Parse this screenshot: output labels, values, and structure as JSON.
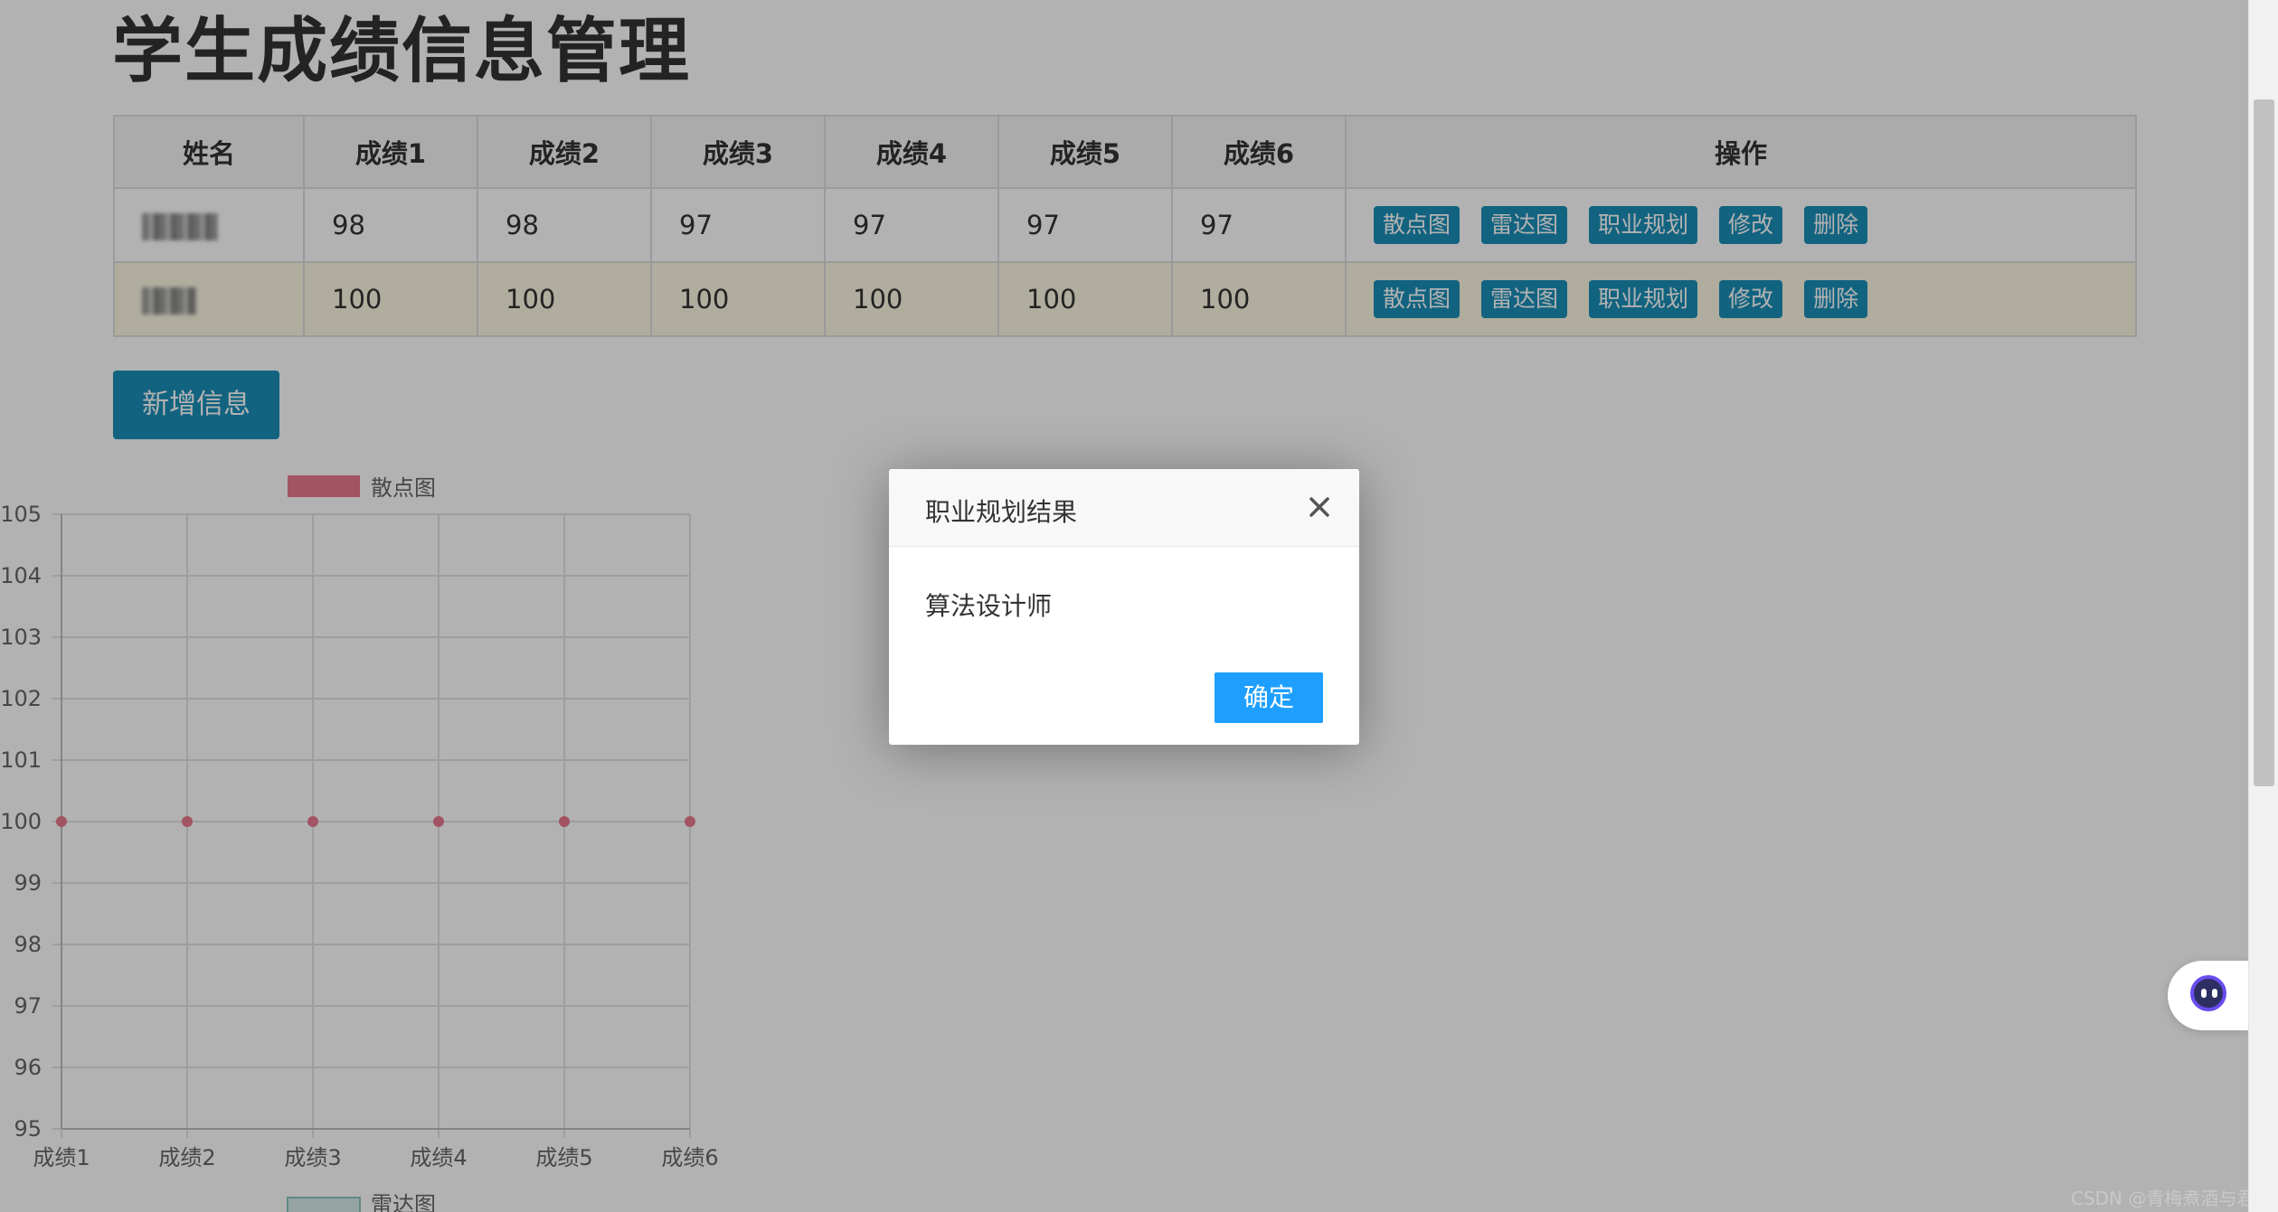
{
  "page": {
    "title": "学生成绩信息管理"
  },
  "table": {
    "headers": [
      "姓名",
      "成绩1",
      "成绩2",
      "成绩3",
      "成绩4",
      "成绩5",
      "成绩6",
      "操作"
    ],
    "rows": [
      {
        "name": "",
        "scores": [
          "98",
          "98",
          "97",
          "97",
          "97",
          "97"
        ]
      },
      {
        "name": "",
        "scores": [
          "100",
          "100",
          "100",
          "100",
          "100",
          "100"
        ]
      }
    ],
    "actions": [
      "散点图",
      "雷达图",
      "职业规划",
      "修改",
      "删除"
    ]
  },
  "add_button": "新增信息",
  "chart_data": {
    "type": "scatter",
    "series": [
      {
        "name": "散点图",
        "color": "#e8798f",
        "x": [
          "成绩1",
          "成绩2",
          "成绩3",
          "成绩4",
          "成绩5",
          "成绩6"
        ],
        "y": [
          100,
          100,
          100,
          100,
          100,
          100
        ]
      }
    ],
    "ylim": [
      95,
      105
    ],
    "yticks": [
      "105",
      "104",
      "103",
      "102",
      "101",
      "100",
      "99",
      "98",
      "97",
      "96",
      "95"
    ],
    "xticks": [
      "成绩1",
      "成绩2",
      "成绩3",
      "成绩4",
      "成绩5",
      "成绩6"
    ],
    "grid": true,
    "legend": [
      "散点图",
      "雷达图"
    ],
    "legend_position": "top"
  },
  "modal": {
    "title": "职业规划结果",
    "body": "算法设计师",
    "ok": "确定"
  },
  "watermark": "CSDN @青梅煮酒与君饮"
}
